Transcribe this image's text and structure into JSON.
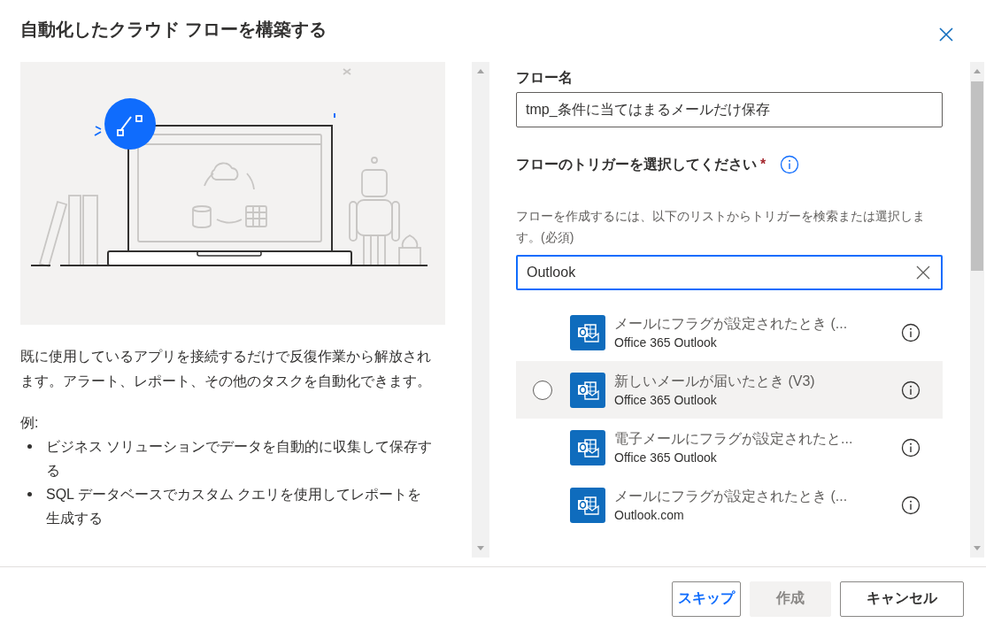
{
  "title": "自動化したクラウド フローを構築する",
  "description": "既に使用しているアプリを接続するだけで反復作業から解放されます。アラート、レポート、その他のタスクを自動化できます。",
  "examples_label": "例:",
  "examples": [
    "ビジネス ソリューションでデータを自動的に収集して保存する",
    "SQL データベースでカスタム クエリを使用してレポートを生成する"
  ],
  "flow_name": {
    "label": "フロー名",
    "value": "tmp_条件に当てはまるメールだけ保存"
  },
  "trigger": {
    "label": "フローのトリガーを選択してください",
    "required_mark": "*",
    "hint": "フローを作成するには、以下のリストからトリガーを検索または選択します。(必須)",
    "search": {
      "value": "Outlook"
    },
    "items": [
      {
        "title": "メールにフラグが設定されたとき (...",
        "connector": "Office 365 Outlook",
        "highlighted": false,
        "selected": false
      },
      {
        "title": "新しいメールが届いたとき (V3)",
        "connector": "Office 365 Outlook",
        "highlighted": true,
        "selected": false
      },
      {
        "title": "電子メールにフラグが設定されたと...",
        "connector": "Office 365 Outlook",
        "highlighted": false,
        "selected": false
      },
      {
        "title": "メールにフラグが設定されたとき (...",
        "connector": "Outlook.com",
        "highlighted": false,
        "selected": false
      }
    ]
  },
  "buttons": [
    {
      "label": "スキップ",
      "kind": "accent-outline",
      "disabled": false
    },
    {
      "label": "作成",
      "kind": "primary",
      "disabled": true
    },
    {
      "label": "キャンセル",
      "kind": "default",
      "disabled": false
    }
  ]
}
